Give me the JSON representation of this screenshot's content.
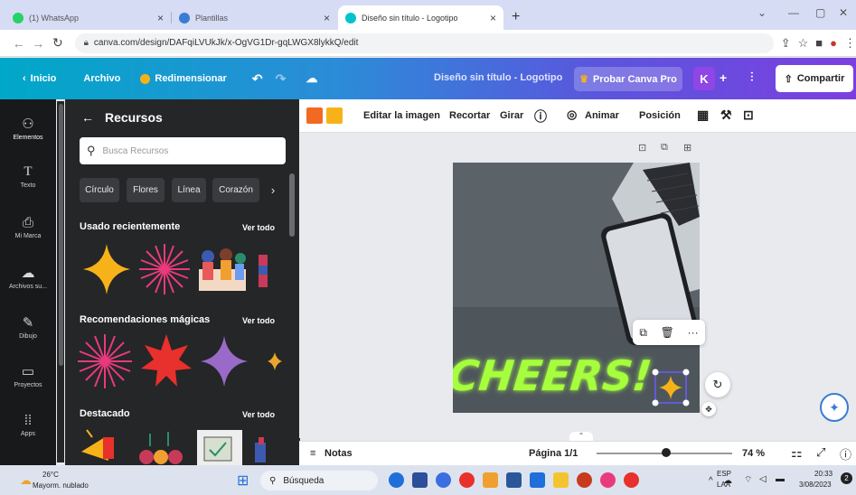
{
  "browser": {
    "tabs": [
      {
        "title": "(1) WhatsApp",
        "color": "#25d366"
      },
      {
        "title": "Plantillas",
        "color": "#3a7bd5"
      },
      {
        "title": "Diseño sin título - Logotipo",
        "color": "#00c4cc"
      }
    ],
    "url": "canva.com/design/DAFqiLVUkJk/x-OgVG1Dr-gqLWGX8lykkQ/edit"
  },
  "canva": {
    "home": "Inicio",
    "file": "Archivo",
    "resize": "Redimensionar",
    "doc_title": "Diseño sin título - Logotipo",
    "pro": "Probar Canva Pro",
    "avatar": "K",
    "share": "Compartir"
  },
  "rail": [
    {
      "label": "Elementos",
      "icon": "elements-icon",
      "glyph": "⚇"
    },
    {
      "label": "Texto",
      "icon": "text-icon",
      "glyph": "T"
    },
    {
      "label": "Mi Marca",
      "icon": "brand-icon",
      "glyph": "⎙"
    },
    {
      "label": "Archivos su...",
      "icon": "upload-icon",
      "glyph": "☁"
    },
    {
      "label": "Dibujo",
      "icon": "draw-icon",
      "glyph": "✎"
    },
    {
      "label": "Proyectos",
      "icon": "folder-icon",
      "glyph": "▭"
    },
    {
      "label": "Apps",
      "icon": "apps-icon",
      "glyph": "⁞⁞"
    }
  ],
  "panel": {
    "title": "Recursos",
    "search_placeholder": "Busca Recursos",
    "chips": [
      "Círculo",
      "Flores",
      "Línea",
      "Corazón"
    ],
    "sections": [
      {
        "title": "Usado recientemente",
        "link": "Ver todo"
      },
      {
        "title": "Recomendaciones mágicas",
        "link": "Ver todo"
      },
      {
        "title": "Destacado",
        "link": "Ver todo"
      }
    ]
  },
  "toolbar": {
    "swatches": [
      "#f26a21",
      "#f7b21a"
    ],
    "edit_image": "Editar la imagen",
    "crop": "Recortar",
    "flip": "Girar",
    "animate": "Animar",
    "position": "Posición"
  },
  "design": {
    "text": "CHEERS!",
    "text_color": "#a6ff3d"
  },
  "bottom": {
    "notes": "Notas",
    "page": "Página 1/1",
    "zoom": "74 %",
    "zoom_level": 74
  },
  "taskbar": {
    "temp": "26°C",
    "weather": "Mayorm. nublado",
    "search": "Búsqueda",
    "lang1": "ESP",
    "lang2": "LAA",
    "time": "20:33",
    "date": "3/08/2023"
  }
}
